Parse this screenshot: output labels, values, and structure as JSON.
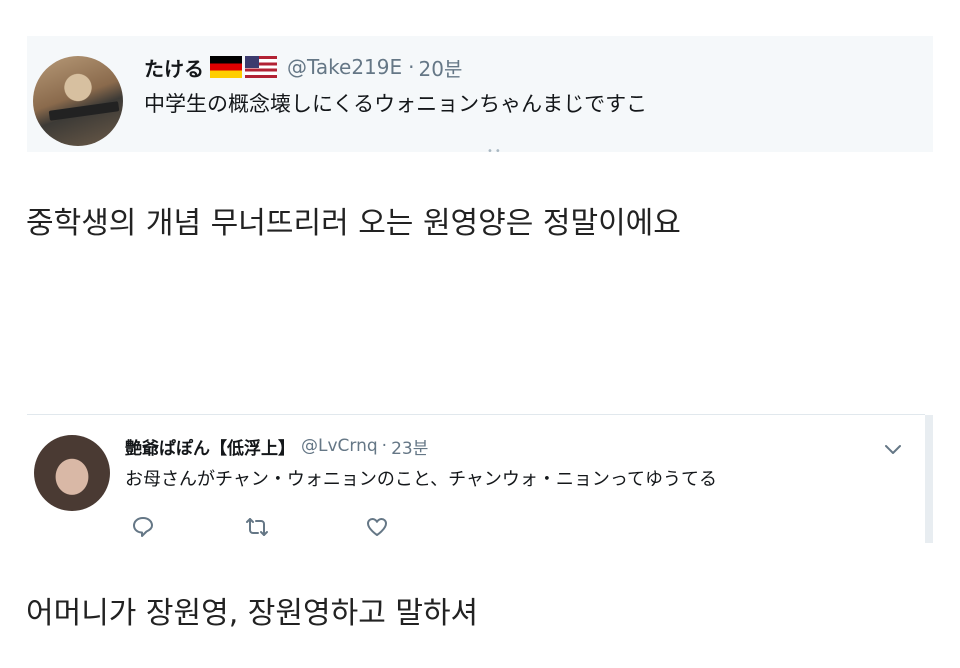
{
  "tweet1": {
    "name": "たける",
    "flags": [
      "germany-flag",
      "usa-flag"
    ],
    "handle": "@Take219E",
    "time": "20분",
    "text": "中学生の概念壊しにくるウォニョンちゃんまじですこ"
  },
  "caption1": "중학생의 개념 무너뜨리러 오는 원영양은 정말이에요",
  "tweet2": {
    "name": "艶爺ぱぽん【低浮上】",
    "handle": "@LvCrnq",
    "time": "23분",
    "text": "お母さんがチャン・ウォニョンのこと、チャンウォ・ニョンってゆうてる"
  },
  "caption2": "어머니가 장원영, 장원영하고 말하셔",
  "colors": {
    "tweet_bg": "#f5f8fa",
    "secondary_text": "#657786",
    "primary_text": "#14171a"
  }
}
